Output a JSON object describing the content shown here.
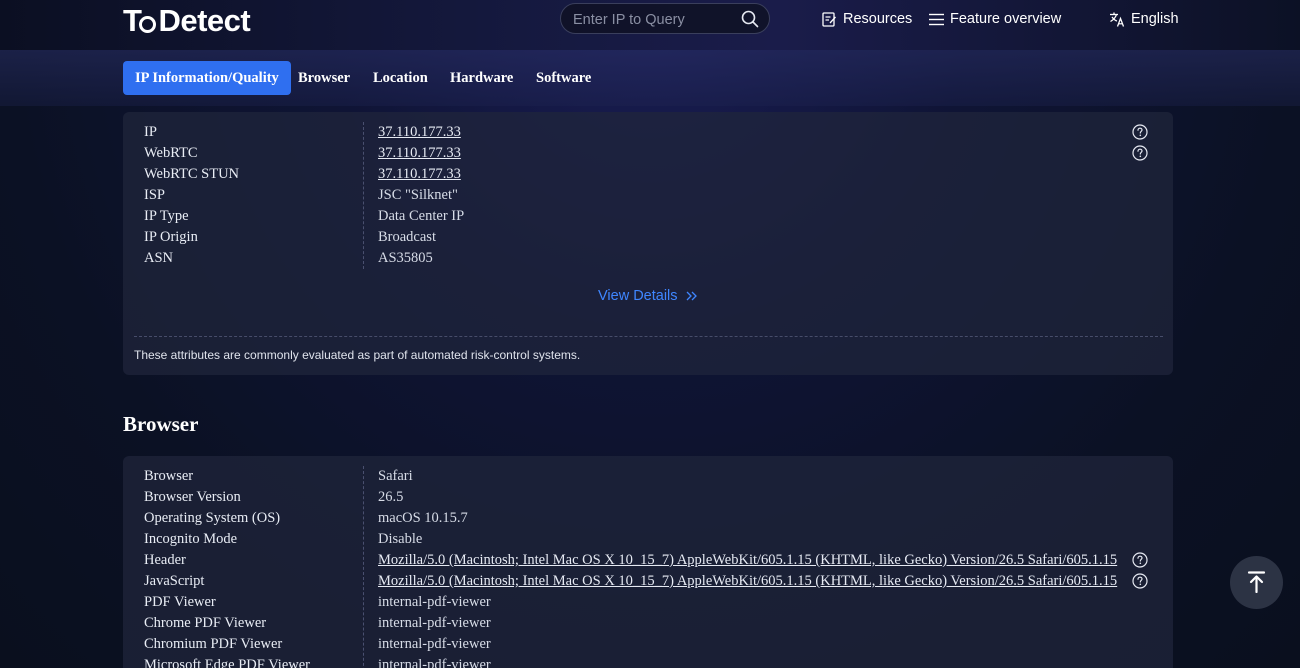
{
  "header": {
    "logo_prefix": "To",
    "logo_suffix": "Detect",
    "search_placeholder": "Enter IP to Query",
    "nav": {
      "resources": "Resources",
      "feature_overview": "Feature overview",
      "language": "English"
    }
  },
  "tabs": [
    {
      "label": "IP Information/Quality",
      "active": true
    },
    {
      "label": "Browser",
      "active": false
    },
    {
      "label": "Location",
      "active": false
    },
    {
      "label": "Hardware",
      "active": false
    },
    {
      "label": "Software",
      "active": false
    }
  ],
  "ip_section": {
    "rows": [
      {
        "label": "IP",
        "value": "37.110.177.33"
      },
      {
        "label": "WebRTC",
        "value": "37.110.177.33"
      },
      {
        "label": "WebRTC STUN",
        "value": "37.110.177.33"
      },
      {
        "label": "ISP",
        "value": "JSC \"Silknet\""
      },
      {
        "label": "IP Type",
        "value": "Data Center IP"
      },
      {
        "label": "IP Origin",
        "value": "Broadcast"
      },
      {
        "label": "ASN",
        "value": "AS35805"
      }
    ],
    "view_details": "View Details",
    "note": "These attributes are commonly evaluated as part of automated risk-control systems."
  },
  "browser_section": {
    "title": "Browser",
    "rows": [
      {
        "label": "Browser",
        "value": "Safari"
      },
      {
        "label": "Browser Version",
        "value": "26.5"
      },
      {
        "label": "Operating System (OS)",
        "value": "macOS 10.15.7"
      },
      {
        "label": "Incognito Mode",
        "value": "Disable"
      },
      {
        "label": "Header",
        "value": "Mozilla/5.0 (Macintosh; Intel Mac OS X 10_15_7) AppleWebKit/605.1.15 (KHTML, like Gecko) Version/26.5 Safari/605.1.15"
      },
      {
        "label": "JavaScript",
        "value": "Mozilla/5.0 (Macintosh; Intel Mac OS X 10_15_7) AppleWebKit/605.1.15 (KHTML, like Gecko) Version/26.5 Safari/605.1.15"
      },
      {
        "label": "PDF Viewer",
        "value": "internal-pdf-viewer"
      },
      {
        "label": "Chrome PDF Viewer",
        "value": "internal-pdf-viewer"
      },
      {
        "label": "Chromium PDF Viewer",
        "value": "internal-pdf-viewer"
      },
      {
        "label": "Microsoft Edge PDF Viewer",
        "value": "internal-pdf-viewer"
      }
    ]
  },
  "colors": {
    "accent": "#2f6ff0",
    "link": "#3f86ff",
    "card_bg": "#20263c"
  },
  "icons": {
    "search": "search-icon",
    "resources": "edit-note-icon",
    "feature_overview": "menu-icon",
    "language": "translate-icon",
    "help": "question-circle-icon",
    "view_details": "double-chevron-right-icon",
    "back_to_top": "arrow-up-to-line-icon"
  }
}
